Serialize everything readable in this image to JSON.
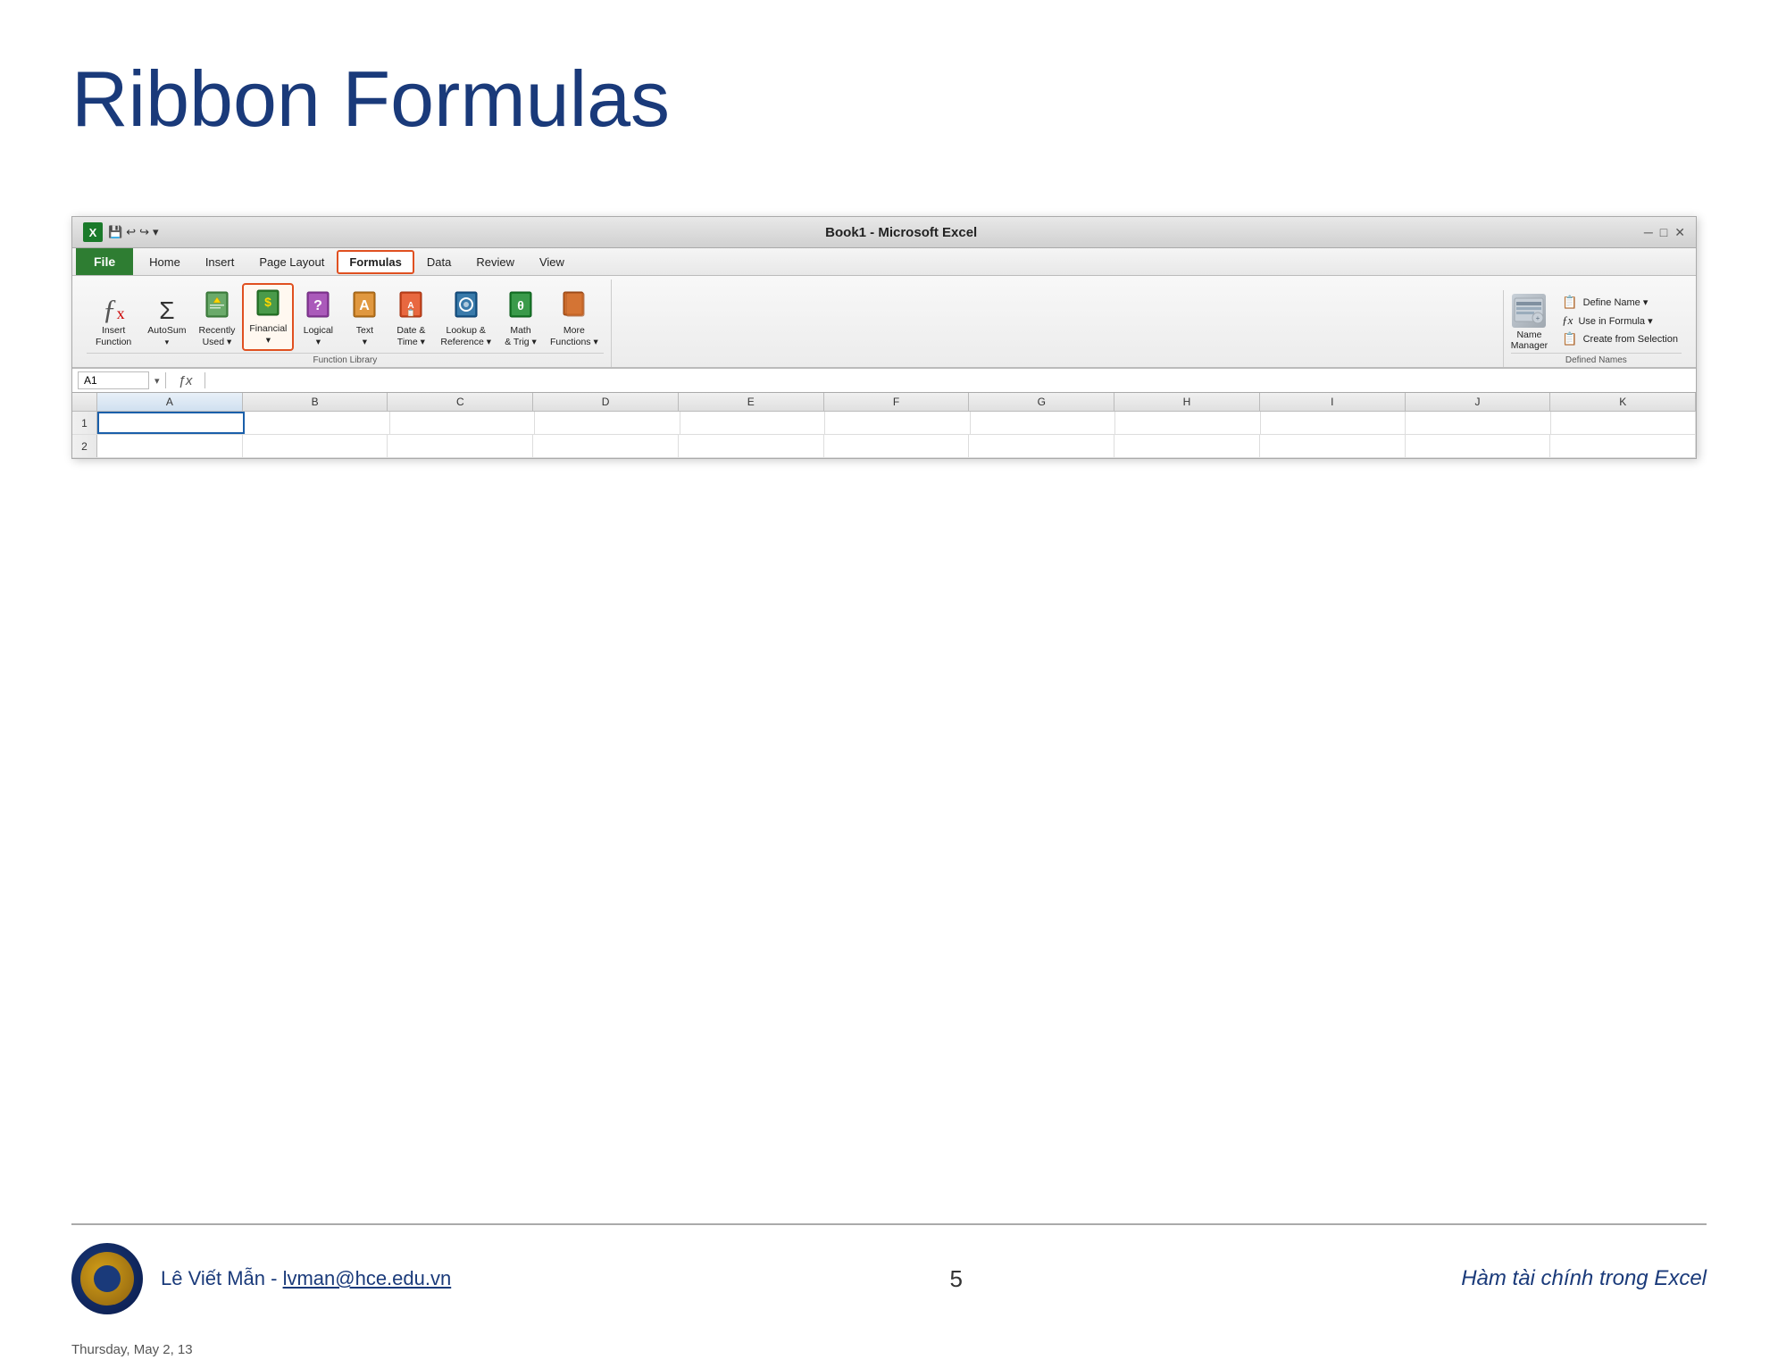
{
  "page": {
    "title": "Ribbon Formulas",
    "background": "#ffffff"
  },
  "excel": {
    "titleBar": {
      "appName": "Book1 - Microsoft Excel",
      "logoText": "X"
    },
    "menuItems": [
      "File",
      "Home",
      "Insert",
      "Page Layout",
      "Formulas",
      "Data",
      "Review",
      "View"
    ],
    "ribbon": {
      "groups": [
        {
          "name": "Function Library",
          "items": [
            {
              "id": "insert-function",
              "label": "Insert\nFunction",
              "icon": "fx"
            },
            {
              "id": "autosum",
              "label": "AutoSum",
              "icon": "Σ"
            },
            {
              "id": "recently-used",
              "label": "Recently\nUsed ▾",
              "icon": "📖"
            },
            {
              "id": "financial",
              "label": "Financial\n▾",
              "icon": "📗",
              "highlighted": true
            },
            {
              "id": "logical",
              "label": "Logical\n▾",
              "icon": "📕"
            },
            {
              "id": "text",
              "label": "Text\n▾",
              "icon": "📙"
            },
            {
              "id": "date-time",
              "label": "Date &\nTime ▾",
              "icon": "📘"
            },
            {
              "id": "lookup-reference",
              "label": "Lookup &\nReference ▾",
              "icon": "📒"
            },
            {
              "id": "math-trig",
              "label": "Math\n& Trig ▾",
              "icon": "📗"
            },
            {
              "id": "more-functions",
              "label": "More\nFunctions ▾",
              "icon": "📙"
            }
          ]
        },
        {
          "name": "Defined Names",
          "items": [
            {
              "id": "name-manager",
              "label": "Name\nManager",
              "icon": "🗂"
            },
            {
              "id": "define-name",
              "label": "Define Name ▾",
              "icon": "📋"
            },
            {
              "id": "use-in-formula",
              "label": "Use in Formula ▾",
              "icon": "fx"
            },
            {
              "id": "create-from-selection",
              "label": "Create from Selection",
              "icon": "📋"
            }
          ]
        }
      ]
    },
    "formulaBar": {
      "nameBox": "A1",
      "content": ""
    },
    "columns": [
      "A",
      "B",
      "C",
      "D",
      "E",
      "F",
      "G",
      "H",
      "I",
      "J",
      "K"
    ],
    "rows": [
      1,
      2
    ]
  },
  "bottom": {
    "authorText": "Lê Viết Mẫn - lvman@hce.edu.vn",
    "authorLink": "lvman@hce.edu.vn",
    "pageNumber": "5",
    "subtitleRight": "Hàm tài chính trong Excel",
    "footerDate": "Thursday, May 2, 13"
  }
}
